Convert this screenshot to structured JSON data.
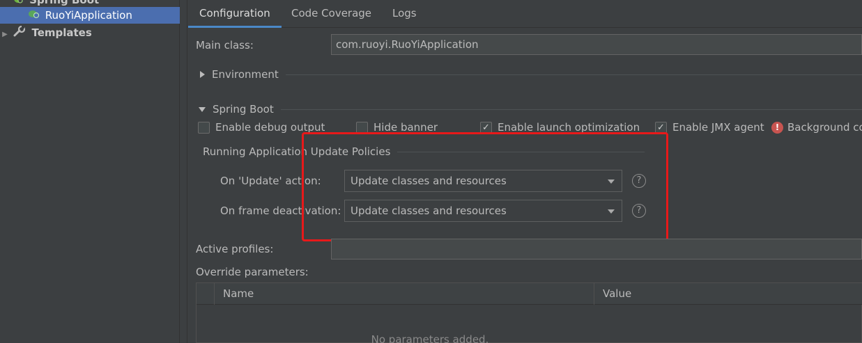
{
  "sidebar": {
    "top_item": "Spring Boot",
    "selected_item": "RuoYiApplication",
    "templates_item": "Templates"
  },
  "tabs": [
    {
      "label": "Configuration"
    },
    {
      "label": "Code Coverage"
    },
    {
      "label": "Logs"
    }
  ],
  "main_class": {
    "label": "Main class:",
    "value": "com.ruoyi.RuoYiApplication"
  },
  "environment": {
    "label": "Environment"
  },
  "spring_boot": {
    "label": "Spring Boot",
    "options": {
      "debug": "Enable debug output",
      "hide_banner": "Hide banner",
      "launch_opt": "Enable launch optimization",
      "jmx": "Enable JMX agent",
      "background": "Background co"
    }
  },
  "policies": {
    "title": "Running Application Update Policies",
    "on_update_label": "On 'Update' action:",
    "on_update_value": "Update classes and resources",
    "on_frame_label": "On frame deactivation:",
    "on_frame_value": "Update classes and resources",
    "help_glyph": "?"
  },
  "active_profiles": {
    "label": "Active profiles:",
    "value": ""
  },
  "override": {
    "label": "Override parameters:",
    "columns": [
      "Name",
      "Value"
    ],
    "empty_text": "No parameters added."
  },
  "icons": {
    "check": "✓",
    "error": "!"
  },
  "colors": {
    "selection": "#4b6eaf",
    "highlight_box": "#e8191a",
    "error": "#c75450",
    "tab_underline": "#4a88c7"
  }
}
